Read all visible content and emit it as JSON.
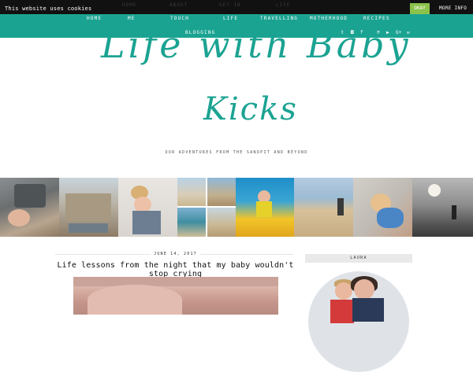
{
  "cookie_bar": {
    "text": "This website uses cookies",
    "okay_label": "OKAY",
    "more_info_label": "MORE INFO",
    "background": "#111111",
    "ghost_nav": [
      "HOME",
      "ABOUT",
      "GET IN",
      "LIFE"
    ]
  },
  "nav": {
    "background": "#1ba392",
    "items": [
      "HOME",
      "ME",
      "TOUCH",
      "LIFE",
      "TRAVELLING",
      "MOTHERHOOD",
      "RECIPES"
    ],
    "second_row": "BLOGGING",
    "social_icons": [
      "twitter-icon",
      "instagram-icon",
      "facebook-icon",
      "plus-icon",
      "pinterest-icon",
      "youtube-icon",
      "google-plus-icon",
      "email-icon"
    ],
    "social_glyphs": [
      "𝕥",
      "◘",
      "f",
      "+",
      "℗",
      "▶",
      "G+",
      "✉"
    ]
  },
  "header": {
    "logo_line1": "Life with Baby",
    "logo_line2": "Kicks",
    "tagline": "OUR ADVENTURES FROM THE SANDPIT AND BEYOND",
    "accent": "#1ba392"
  },
  "gallery": {
    "photos": [
      "sink-photo",
      "building-photo",
      "sleeping-toddler-photo",
      "beach-collage-photo",
      "waterslide-photo",
      "beach-child-photo",
      "child-by-wall-photo",
      "sunset-photo"
    ]
  },
  "post": {
    "date": "JUNE 14, 2017",
    "title": "Life lessons from the night that my baby wouldn't stop crying"
  },
  "sidebar": {
    "heading": "LAURA"
  }
}
